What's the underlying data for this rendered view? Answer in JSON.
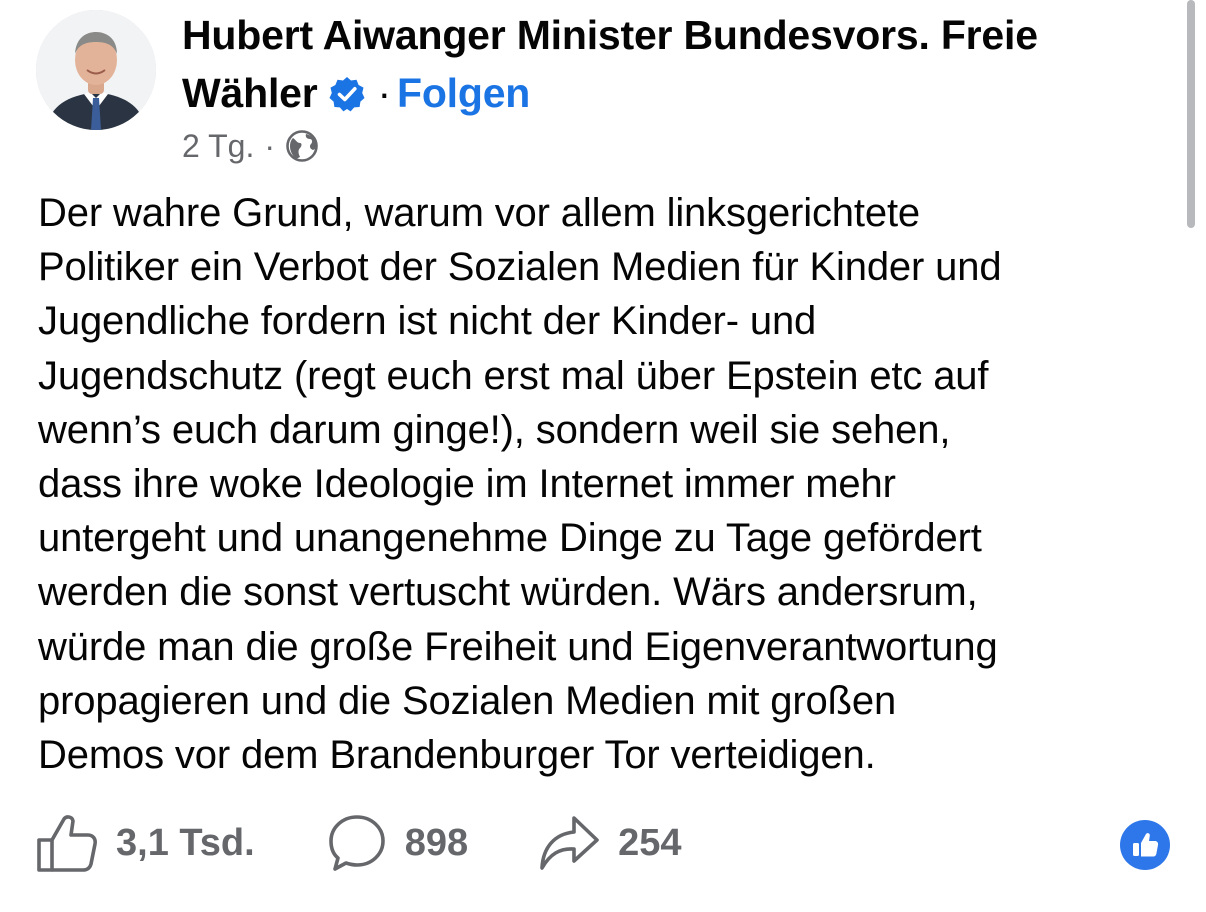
{
  "post": {
    "author": "Hubert Aiwanger Minister Bundesvors. Freie Wähler",
    "follow_label": "Folgen",
    "separator": "·",
    "timestamp": "2 Tg.",
    "audience_icon": "globe-icon",
    "text": "Der wahre Grund, warum vor allem linksgerichtete\nPolitiker ein Verbot der Sozialen Medien für Kinder und\nJugendliche fordern ist nicht der Kinder- und\nJugendschutz (regt euch erst mal über Epstein etc auf\nwenn’s euch darum ginge!), sondern weil sie sehen,\ndass ihre woke Ideologie im Internet immer mehr\nuntergeht und unangenehme Dinge zu Tage gefördert\nwerden die sonst vertuscht würden. Wärs andersrum,\nwürde man die große Freiheit und Eigenverantwortung\npropagieren und die Sozialen Medien mit großen\nDemos vor dem Brandenburger Tor verteidigen."
  },
  "actions": {
    "likes": "3,1 Tsd.",
    "comments": "898",
    "shares": "254"
  },
  "colors": {
    "accent": "#1b74e4",
    "secondary_text": "#65676b",
    "reaction_blue": "#2d77ea"
  }
}
